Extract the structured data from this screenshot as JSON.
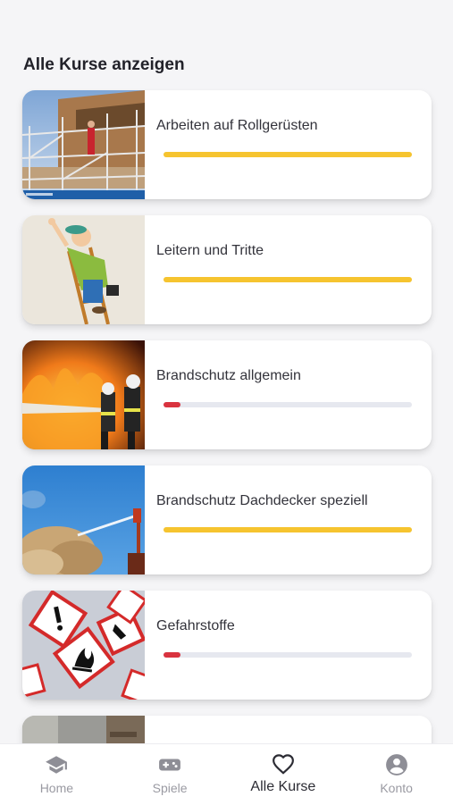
{
  "header": {
    "title": "Alle Kurse anzeigen"
  },
  "colors": {
    "progress_complete": "#f6c42f",
    "progress_started": "#d9333f",
    "progress_track": "#e6e8ef",
    "nav_active": "#2c2c34",
    "nav_inactive": "#9a9aa2"
  },
  "courses": [
    {
      "title": "Arbeiten auf Rollgerüsten",
      "progress": 1.0,
      "image": "scaffolding-photo"
    },
    {
      "title": "Leitern und Tritte",
      "progress": 1.0,
      "image": "ladder-cartoon"
    },
    {
      "title": "Brandschutz allgemein",
      "progress": 0.07,
      "image": "firefighters-photo"
    },
    {
      "title": "Brandschutz Dachdecker speziell",
      "progress": 1.0,
      "image": "fire-hose-photo"
    },
    {
      "title": "Gefahrstoffe",
      "progress": 0.07,
      "image": "hazard-symbols-photo"
    }
  ],
  "bottom_nav": {
    "items": [
      {
        "label": "Home",
        "icon": "graduation-cap-icon",
        "active": false
      },
      {
        "label": "Spiele",
        "icon": "gamepad-icon",
        "active": false
      },
      {
        "label": "Alle Kurse",
        "icon": "heart-icon",
        "active": true
      },
      {
        "label": "Konto",
        "icon": "account-icon",
        "active": false
      }
    ]
  }
}
